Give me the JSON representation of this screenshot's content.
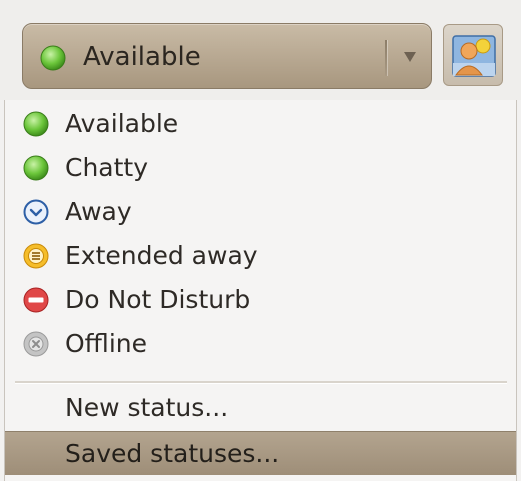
{
  "status_selector": {
    "current_label": "Available",
    "current_icon": "available-icon",
    "avatar_icon": "buddy-avatar-icon"
  },
  "menu": {
    "statuses": [
      {
        "label": "Available",
        "icon": "available-icon",
        "color": "#4caf2a"
      },
      {
        "label": "Chatty",
        "icon": "chatty-icon",
        "color": "#4caf2a"
      },
      {
        "label": "Away",
        "icon": "away-clock-icon",
        "color": "#3a6fb5"
      },
      {
        "label": "Extended away",
        "icon": "extended-away-icon",
        "color": "#e8a413"
      },
      {
        "label": "Do Not Disturb",
        "icon": "do-not-disturb-icon",
        "color": "#d83a3a"
      },
      {
        "label": "Offline",
        "icon": "offline-icon",
        "color": "#a8a8a8"
      }
    ],
    "new_status_label": "New status...",
    "saved_statuses_label": "Saved statuses...",
    "highlighted_item": "Saved statuses..."
  }
}
